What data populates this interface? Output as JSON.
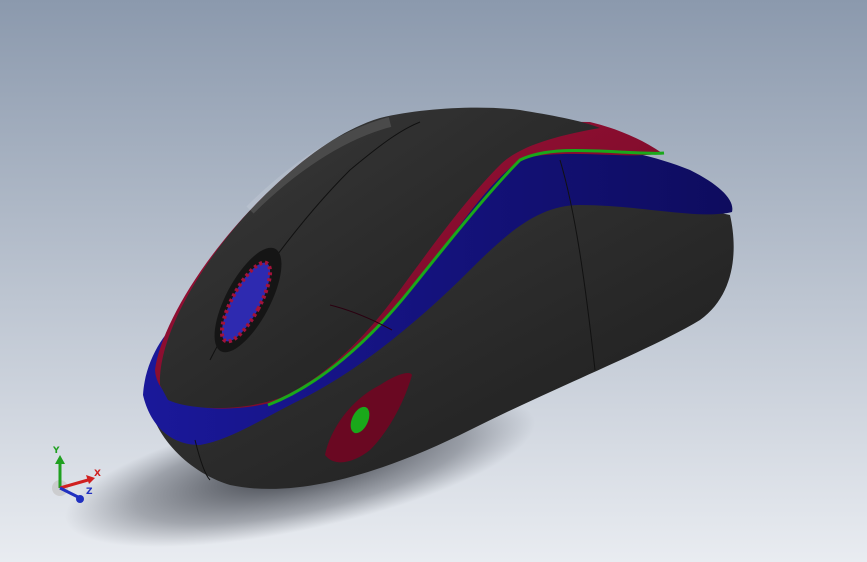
{
  "viewport": {
    "background_top": "#8b99ad",
    "background_bottom": "#e9ecf1"
  },
  "model": {
    "colors": {
      "shell_black": "#2b2b2b",
      "stripe_red": "#8a0a2e",
      "band_blue": "#12107a",
      "edge_green": "#1aa81a"
    }
  },
  "triad": {
    "x_label": "X",
    "y_label": "Y",
    "z_label": "Z",
    "x_color": "#d02020",
    "y_color": "#20a020",
    "z_color": "#2030c0"
  }
}
